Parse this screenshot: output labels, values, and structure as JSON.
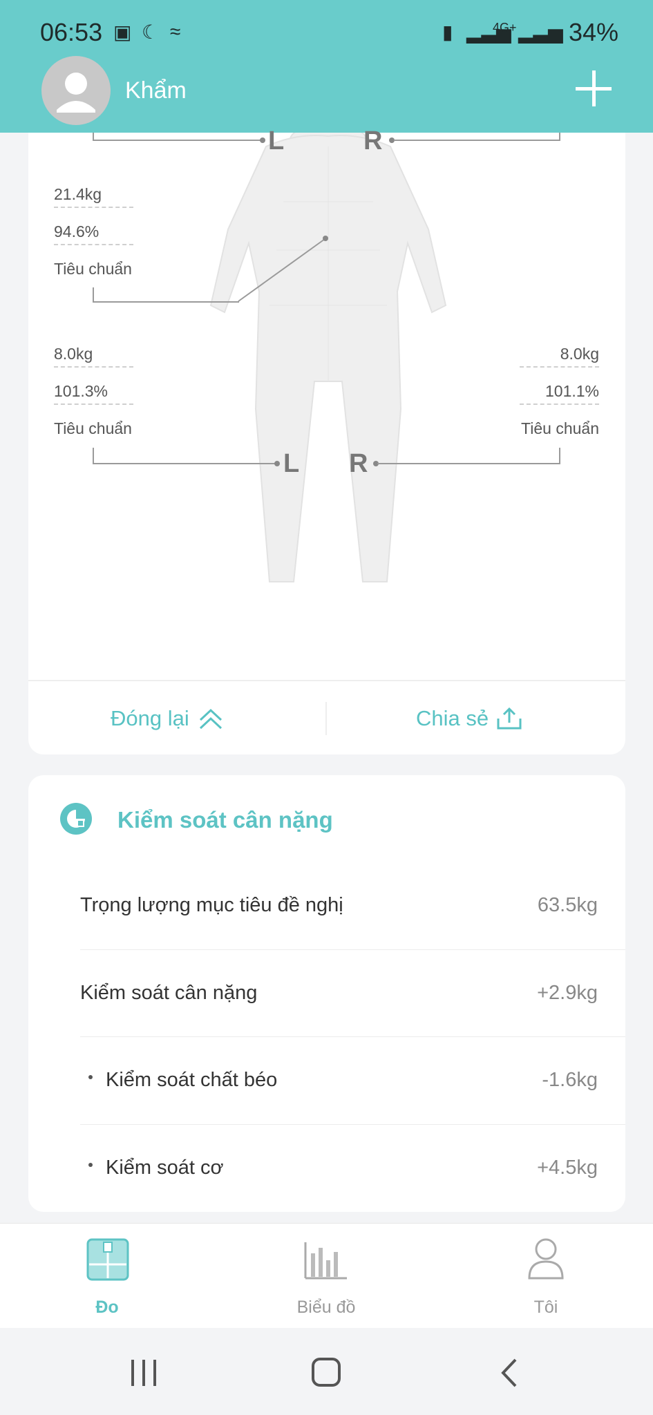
{
  "status_bar": {
    "time": "06:53",
    "network": "4G+",
    "battery": "34%"
  },
  "header": {
    "user_name": "Khẩm"
  },
  "body_figure": {
    "top_left_marker": "L",
    "top_right_marker": "R",
    "trunk": {
      "weight": "21.4kg",
      "percent": "94.6%",
      "status": "Tiêu chuẩn"
    },
    "left_leg": {
      "weight": "8.0kg",
      "percent": "101.3%",
      "status": "Tiêu chuẩn"
    },
    "right_leg": {
      "weight": "8.0kg",
      "percent": "101.1%",
      "status": "Tiêu chuẩn"
    },
    "leg_left_marker": "L",
    "leg_right_marker": "R"
  },
  "actions": {
    "close_label": "Đóng lại",
    "share_label": "Chia sẻ"
  },
  "weight_control": {
    "title": "Kiểm soát cân nặng",
    "rows": [
      {
        "label": "Trọng lượng mục tiêu đề nghị",
        "value": "63.5kg"
      },
      {
        "label": "Kiểm soát cân nặng",
        "value": "+2.9kg"
      },
      {
        "label": "Kiểm soát chất béo",
        "value": "-1.6kg"
      },
      {
        "label": "Kiểm soát cơ",
        "value": "+4.5kg"
      }
    ]
  },
  "bottom_nav": {
    "measure": "Đo",
    "chart": "Biểu đồ",
    "me": "Tôi"
  },
  "colors": {
    "accent": "#69cccb",
    "text_accent": "#58c2c3"
  }
}
